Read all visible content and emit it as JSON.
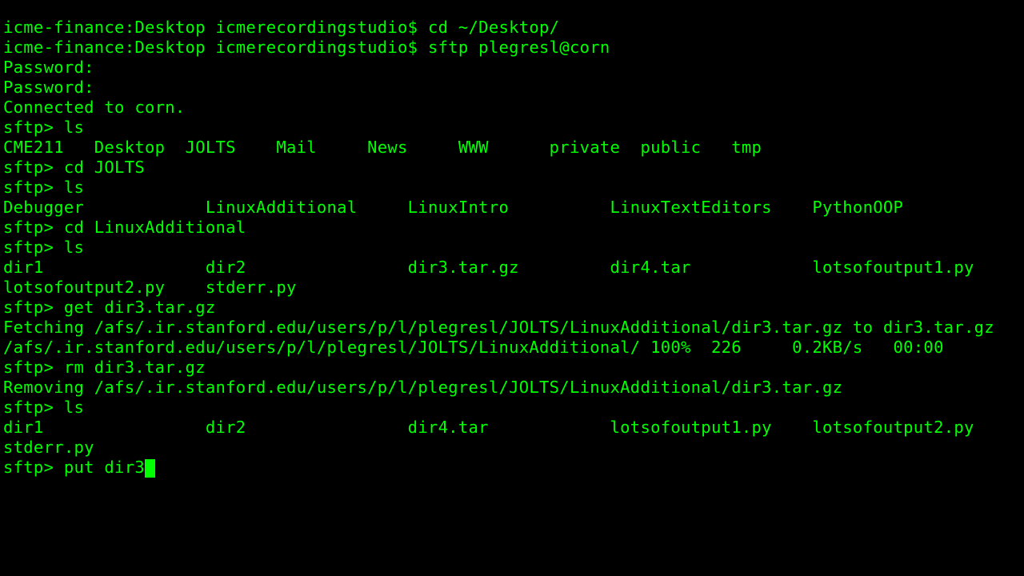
{
  "lines": {
    "l0": "icme-finance:Desktop icmerecordingstudio$ cd ~/Desktop/",
    "l1": "icme-finance:Desktop icmerecordingstudio$ sftp plegresl@corn",
    "l2": "Password:",
    "l3": "Password:",
    "l4": "Connected to corn.",
    "l5": "sftp> ls",
    "l6": "CME211   Desktop  JOLTS    Mail     News     WWW      private  public   tmp",
    "l7": "sftp> cd JOLTS",
    "l8": "sftp> ls",
    "l9": "Debugger            LinuxAdditional     LinuxIntro          LinuxTextEditors    PythonOOP",
    "l10": "sftp> cd LinuxAdditional",
    "l11": "sftp> ls",
    "l12": "dir1                dir2                dir3.tar.gz         dir4.tar            lotsofoutput1.py",
    "l13": "lotsofoutput2.py    stderr.py",
    "l14": "sftp> get dir3.tar.gz",
    "l15": "Fetching /afs/.ir.stanford.edu/users/p/l/plegresl/JOLTS/LinuxAdditional/dir3.tar.gz to dir3.tar.gz",
    "l16": "/afs/.ir.stanford.edu/users/p/l/plegresl/JOLTS/LinuxAdditional/ 100%  226     0.2KB/s   00:00",
    "l17": "sftp> rm dir3.tar.gz",
    "l18": "Removing /afs/.ir.stanford.edu/users/p/l/plegresl/JOLTS/LinuxAdditional/dir3.tar.gz",
    "l19": "sftp> ls",
    "l20": "dir1                dir2                dir4.tar            lotsofoutput1.py    lotsofoutput2.py",
    "l21": "stderr.py",
    "l22": "sftp> put dir3"
  }
}
